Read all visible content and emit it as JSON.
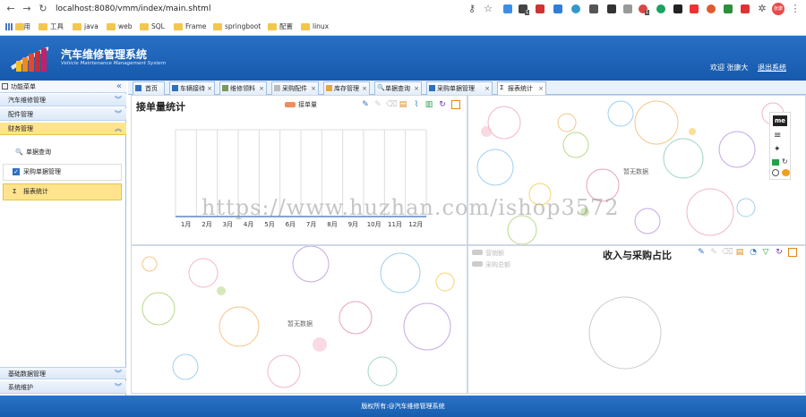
{
  "browser": {
    "url": "localhost:8080/vmm/index/main.shtml",
    "bookmarks": [
      "应用",
      "工具",
      "java",
      "web",
      "SQL",
      "Frame",
      "springboot",
      "配置",
      "linux"
    ],
    "ext_badge_a": "1",
    "ext_badge_b": "1",
    "profile": "张康"
  },
  "header": {
    "title": "汽车维修管理系统",
    "subtitle": "Vehicle Maintenance Management System",
    "welcome": "欢迎 张康大",
    "logout": "退出系统"
  },
  "sidebar": {
    "title": "功能菜单",
    "sections_top": [
      "汽车维修管理",
      "配件管理",
      "财务管理"
    ],
    "items": [
      "单据查询",
      "采购单据管理",
      "报表统计"
    ],
    "sections_bottom": [
      "基础数据管理",
      "系统维护"
    ]
  },
  "tabs": [
    "首页",
    "车辆接待",
    "维修领料",
    "采购配件",
    "库存管理",
    "单据查询",
    "采购单据管理",
    "报表统计"
  ],
  "charts": {
    "bar": {
      "title": "接单量统计",
      "legend": "接单量",
      "nodata": "暂无数据"
    },
    "pie": {
      "title": "收入与采购占比",
      "legend": [
        "营销额",
        "采购总额"
      ]
    },
    "empty_nodata": "暂无数据",
    "toolbox_tag": "me"
  },
  "chart_data": {
    "type": "bar",
    "title": "接单量统计",
    "categories": [
      "1月",
      "2月",
      "3月",
      "4月",
      "5月",
      "6月",
      "7月",
      "8月",
      "9月",
      "10月",
      "11月",
      "12月"
    ],
    "series": [
      {
        "name": "接单量",
        "values": [
          0,
          0,
          0,
          0,
          0,
          0,
          0,
          0,
          0,
          0,
          0,
          0
        ]
      }
    ]
  },
  "footer": "版权所有:@汽车维修管理系统",
  "watermark": "https://www.huzhan.com/ishop3572",
  "colors": {
    "header": "#1a63b8",
    "accent": "#ffe48d",
    "bar": "#f28c5c"
  }
}
